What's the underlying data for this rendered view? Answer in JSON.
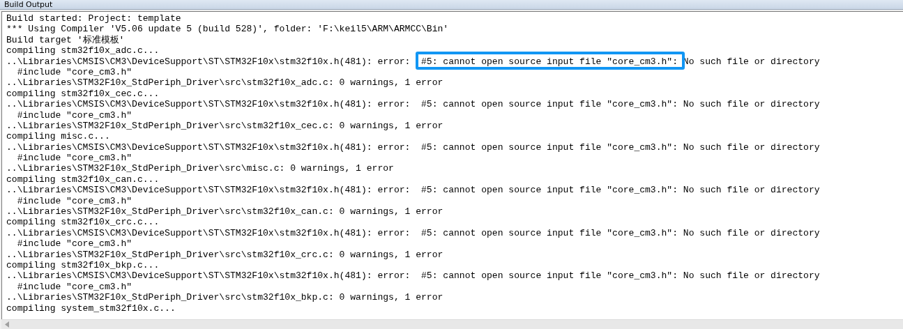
{
  "window": {
    "title": "Build Output"
  },
  "lines": [
    {
      "text": "Build started: Project: template",
      "highlighted": false
    },
    {
      "text": "*** Using Compiler 'V5.06 update 5 (build 528)', folder: 'F:\\keil5\\ARM\\ARMCC\\Bin'",
      "highlighted": false
    },
    {
      "text": "Build target '标准模板'",
      "highlighted": false
    },
    {
      "text": "compiling stm32f10x_adc.c...",
      "highlighted": false
    },
    {
      "text": "..\\Libraries\\CMSIS\\CM3\\DeviceSupport\\ST\\STM32F10x\\stm32f10x.h(481): error:  #5: cannot open source input file \"core_cm3.h\": No such file or directory",
      "highlighted": true
    },
    {
      "text": "  #include \"core_cm3.h\"",
      "highlighted": false
    },
    {
      "text": "..\\Libraries\\STM32F10x_StdPeriph_Driver\\src\\stm32f10x_adc.c: 0 warnings, 1 error",
      "highlighted": false
    },
    {
      "text": "compiling stm32f10x_cec.c...",
      "highlighted": false
    },
    {
      "text": "..\\Libraries\\CMSIS\\CM3\\DeviceSupport\\ST\\STM32F10x\\stm32f10x.h(481): error:  #5: cannot open source input file \"core_cm3.h\": No such file or directory",
      "highlighted": false
    },
    {
      "text": "  #include \"core_cm3.h\"",
      "highlighted": false
    },
    {
      "text": "..\\Libraries\\STM32F10x_StdPeriph_Driver\\src\\stm32f10x_cec.c: 0 warnings, 1 error",
      "highlighted": false
    },
    {
      "text": "compiling misc.c...",
      "highlighted": false
    },
    {
      "text": "..\\Libraries\\CMSIS\\CM3\\DeviceSupport\\ST\\STM32F10x\\stm32f10x.h(481): error:  #5: cannot open source input file \"core_cm3.h\": No such file or directory",
      "highlighted": false
    },
    {
      "text": "  #include \"core_cm3.h\"",
      "highlighted": false
    },
    {
      "text": "..\\Libraries\\STM32F10x_StdPeriph_Driver\\src\\misc.c: 0 warnings, 1 error",
      "highlighted": false
    },
    {
      "text": "compiling stm32f10x_can.c...",
      "highlighted": false
    },
    {
      "text": "..\\Libraries\\CMSIS\\CM3\\DeviceSupport\\ST\\STM32F10x\\stm32f10x.h(481): error:  #5: cannot open source input file \"core_cm3.h\": No such file or directory",
      "highlighted": false
    },
    {
      "text": "  #include \"core_cm3.h\"",
      "highlighted": false
    },
    {
      "text": "..\\Libraries\\STM32F10x_StdPeriph_Driver\\src\\stm32f10x_can.c: 0 warnings, 1 error",
      "highlighted": false
    },
    {
      "text": "compiling stm32f10x_crc.c...",
      "highlighted": false
    },
    {
      "text": "..\\Libraries\\CMSIS\\CM3\\DeviceSupport\\ST\\STM32F10x\\stm32f10x.h(481): error:  #5: cannot open source input file \"core_cm3.h\": No such file or directory",
      "highlighted": false
    },
    {
      "text": "  #include \"core_cm3.h\"",
      "highlighted": false
    },
    {
      "text": "..\\Libraries\\STM32F10x_StdPeriph_Driver\\src\\stm32f10x_crc.c: 0 warnings, 1 error",
      "highlighted": false
    },
    {
      "text": "compiling stm32f10x_bkp.c...",
      "highlighted": false
    },
    {
      "text": "..\\Libraries\\CMSIS\\CM3\\DeviceSupport\\ST\\STM32F10x\\stm32f10x.h(481): error:  #5: cannot open source input file \"core_cm3.h\": No such file or directory",
      "highlighted": false
    },
    {
      "text": "  #include \"core_cm3.h\"",
      "highlighted": false
    },
    {
      "text": "..\\Libraries\\STM32F10x_StdPeriph_Driver\\src\\stm32f10x_bkp.c: 0 warnings, 1 error",
      "highlighted": false
    },
    {
      "text": "compiling system_stm32f10x.c...",
      "highlighted": false
    }
  ]
}
